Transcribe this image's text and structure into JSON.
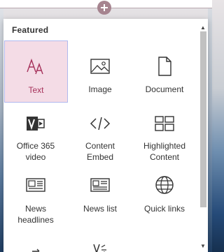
{
  "canvas": {
    "add_button": "+"
  },
  "toolbox": {
    "section_title": "Featured",
    "tiles": [
      {
        "label": "Text",
        "icon": "text-icon",
        "selected": true
      },
      {
        "label": "Image",
        "icon": "image-icon"
      },
      {
        "label": "Document",
        "icon": "document-icon"
      },
      {
        "label": "Office 365\nvideo",
        "icon": "video-icon"
      },
      {
        "label": "Content\nEmbed",
        "icon": "code-embed-icon"
      },
      {
        "label": "Highlighted\nContent",
        "icon": "highlighted-content-icon"
      },
      {
        "label": "News\nheadlines",
        "icon": "news-headlines-icon"
      },
      {
        "label": "News list",
        "icon": "news-list-icon"
      },
      {
        "label": "Quick links",
        "icon": "globe-icon"
      }
    ],
    "scroll": {
      "up": "▲",
      "down": "▼"
    }
  },
  "colors": {
    "accent": "#a6325b",
    "selected_bg": "#f4dce6",
    "add_button": "#a6848f"
  }
}
